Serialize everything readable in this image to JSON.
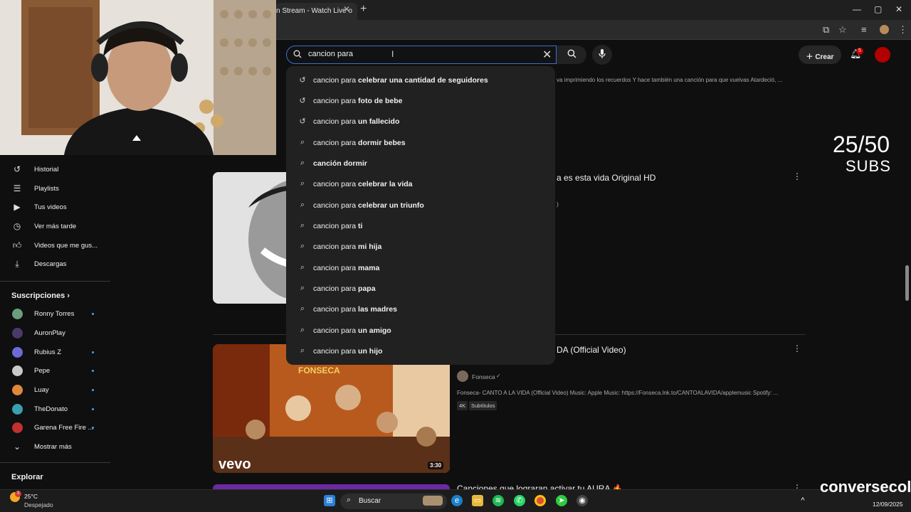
{
  "browser": {
    "tab_title": "n Stream - Watch Live o",
    "tab_close": "✕",
    "new_tab": "+",
    "controls": {
      "minimize": "—",
      "maximize": "▢",
      "close": "✕"
    }
  },
  "search": {
    "query": "cancion para",
    "clear_icon": "✕",
    "search_icon": "search-icon",
    "mic_icon": "mic-icon"
  },
  "header": {
    "create_label": "Crear",
    "notifications_count": "5"
  },
  "suggestions": [
    {
      "icon": "history",
      "prefix": "cancion para ",
      "suffix": "celebrar una cantidad de seguidores"
    },
    {
      "icon": "history",
      "prefix": "cancion para ",
      "suffix": "foto de bebe"
    },
    {
      "icon": "history",
      "prefix": "cancion para ",
      "suffix": "un fallecido"
    },
    {
      "icon": "search",
      "prefix": "cancion para ",
      "suffix": "dormir bebes"
    },
    {
      "icon": "search",
      "prefix": "",
      "suffix": "canción dormir"
    },
    {
      "icon": "search",
      "prefix": "cancion para ",
      "suffix": "celebrar la vida"
    },
    {
      "icon": "search",
      "prefix": "cancion para ",
      "suffix": "celebrar un triunfo"
    },
    {
      "icon": "search",
      "prefix": "cancion para ",
      "suffix": "ti"
    },
    {
      "icon": "search",
      "prefix": "cancion para ",
      "suffix": "mi hija"
    },
    {
      "icon": "search",
      "prefix": "cancion para ",
      "suffix": "mama"
    },
    {
      "icon": "search",
      "prefix": "cancion para ",
      "suffix": "papa"
    },
    {
      "icon": "search",
      "prefix": "cancion para ",
      "suffix": "las madres"
    },
    {
      "icon": "search",
      "prefix": "cancion para ",
      "suffix": "un amigo"
    },
    {
      "icon": "search",
      "prefix": "cancion para ",
      "suffix": "un hijo"
    }
  ],
  "sidebar": {
    "items": [
      {
        "icon": "history-icon",
        "label": "Historial"
      },
      {
        "icon": "playlists-icon",
        "label": "Playlists"
      },
      {
        "icon": "your-videos-icon",
        "label": "Tus videos"
      },
      {
        "icon": "watch-later-icon",
        "label": "Ver más tarde"
      },
      {
        "icon": "like-icon",
        "label": "Videos que me gus..."
      },
      {
        "icon": "download-icon",
        "label": "Descargas"
      }
    ],
    "subscriptions_title": "Suscripciones",
    "subscriptions": [
      {
        "label": "Ronny Torres",
        "color": "#6a9e7f",
        "dot": true
      },
      {
        "label": "AuronPlay",
        "color": "#4a3a6a",
        "dot": false
      },
      {
        "label": "Rubius Z",
        "color": "#6b6bd6",
        "dot": true
      },
      {
        "label": "Pepe",
        "color": "#c9c9c9",
        "dot": true
      },
      {
        "label": "Luay",
        "color": "#e0883a",
        "dot": true
      },
      {
        "label": "TheDonato",
        "color": "#3aa0b0",
        "dot": true
      },
      {
        "label": "Garena Free Fire ...",
        "color": "#c23030",
        "dot": true
      }
    ],
    "show_more": "Mostrar más",
    "explore_title": "Explorar"
  },
  "results": {
    "top_snippet": "va imprimiendo los recuerdos Y hace también una canción para que vuelvas Atardeció, ...",
    "second_title": "a es esta vida Original HD",
    "second_meta": ")",
    "third_title": "DA (Official Video)",
    "third_channel": "Fonseca",
    "third_desc": "Fonseca- CANTO A LA VIDA (Official Video) Music: Apple Music: https://Fonseca.lnk.to/CANTOALAVIDA/applemusic Spotify: ...",
    "badge_4k": "4K",
    "badge_subs": "Subtítulos",
    "third_duration": "3:30",
    "thumb_brand": "FONSECA",
    "thumb_logo": "vevo",
    "fourth_title": "Canciones que lograran activar tu AURA 🔥"
  },
  "overlay": {
    "subs_count": "25/50",
    "subs_label": "SUBS",
    "watermark": "conversecol"
  },
  "taskbar": {
    "temp": "25°C",
    "condition": "Despejado",
    "weather_badge": "3",
    "search_label": "Buscar",
    "date": "12/09/2025"
  },
  "colors": {
    "accent_blue": "#3ea6ff",
    "youtube_red": "#cc0000",
    "search_focus": "#3b6fd4"
  }
}
